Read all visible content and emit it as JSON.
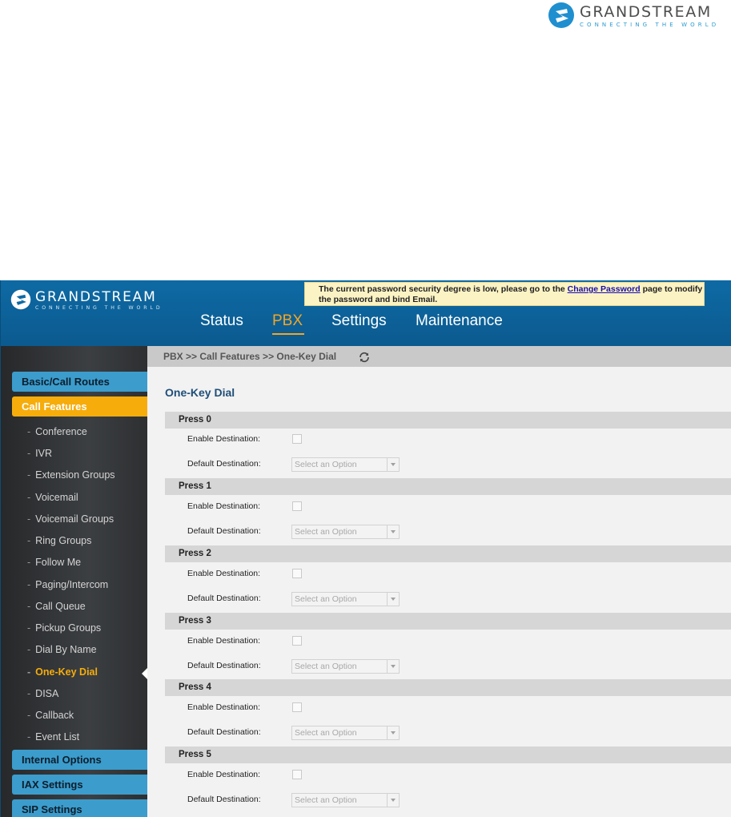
{
  "doc_logo": {
    "name": "GRANDSTREAM",
    "tagline": "CONNECTING THE WORLD"
  },
  "app": {
    "logo": {
      "name": "GRANDSTREAM",
      "tagline": "CONNECTING THE WORLD"
    },
    "notice": {
      "text_before": "The current password security degree is low, please go to the ",
      "link": "Change Password",
      "text_after": " page to modify the password and bind Email."
    },
    "nav": [
      "Status",
      "PBX",
      "Settings",
      "Maintenance"
    ],
    "nav_active": "PBX",
    "sidebar": {
      "sections": [
        "Basic/Call Routes",
        "Call Features",
        "Internal Options",
        "IAX Settings",
        "SIP Settings"
      ],
      "active_section": "Call Features",
      "items": [
        "Conference",
        "IVR",
        "Extension Groups",
        "Voicemail",
        "Voicemail Groups",
        "Ring Groups",
        "Follow Me",
        "Paging/Intercom",
        "Call Queue",
        "Pickup Groups",
        "Dial By Name",
        "One-Key Dial",
        "DISA",
        "Callback",
        "Event List"
      ],
      "active_item": "One-Key Dial",
      "dash": "-"
    },
    "breadcrumb": "PBX >> Call Features >> One-Key Dial",
    "page_title": "One-Key Dial",
    "presses": [
      {
        "label": "Press 0",
        "enable_label": "Enable Destination:",
        "default_label": "Default Destination:",
        "select_placeholder": "Select an Option",
        "enabled": false
      },
      {
        "label": "Press 1",
        "enable_label": "Enable Destination:",
        "default_label": "Default Destination:",
        "select_placeholder": "Select an Option",
        "enabled": false
      },
      {
        "label": "Press 2",
        "enable_label": "Enable Destination:",
        "default_label": "Default Destination:",
        "select_placeholder": "Select an Option",
        "enabled": false
      },
      {
        "label": "Press 3",
        "enable_label": "Enable Destination:",
        "default_label": "Default Destination:",
        "select_placeholder": "Select an Option",
        "enabled": false
      },
      {
        "label": "Press 4",
        "enable_label": "Enable Destination:",
        "default_label": "Default Destination:",
        "select_placeholder": "Select an Option",
        "enabled": false
      },
      {
        "label": "Press 5",
        "enable_label": "Enable Destination:",
        "default_label": "Default Destination:",
        "select_placeholder": "Select an Option",
        "enabled": false
      }
    ],
    "colors": {
      "header_blue": "#0e6aa4",
      "accent_orange": "#f6ad0c",
      "section_blue": "#3c9ccc",
      "title_blue": "#1f4e79"
    },
    "icons": {
      "refresh": "refresh-icon",
      "logo": "grandstream-logo-icon"
    }
  }
}
